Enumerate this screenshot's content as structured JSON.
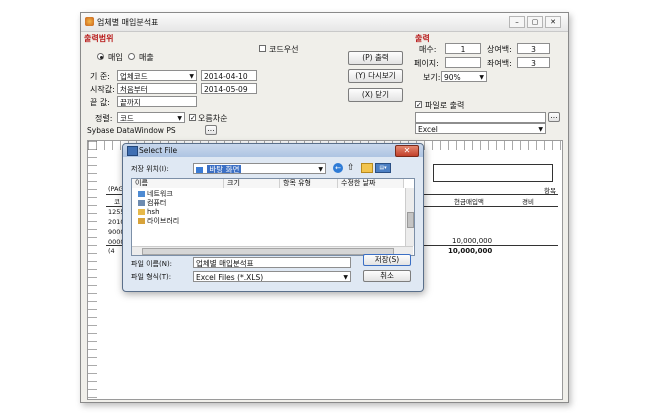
{
  "window": {
    "title": "업체별 매입분석표"
  },
  "output_range": {
    "heading": "출력범위",
    "radio_purchase": "매입",
    "radio_sale": "매출",
    "code_priority": "코드우선",
    "criteria_label": "기 준:",
    "criteria_value": "업체코드",
    "date_from": "2014-04-10",
    "start_label": "시작값:",
    "start_value": "처음부터",
    "date_to": "2014-05-09",
    "end_label": "끝 값:",
    "end_value": "끝까지",
    "sort_label": "정렬:",
    "sort_value": "코드",
    "ascending": "오름차순",
    "datawindow": "Sybase DataWindow PS",
    "browse": "..."
  },
  "buttons": {
    "print": "(P) 출력",
    "saveas": "(Y) 다시보기",
    "close": "(X) 닫기"
  },
  "print_panel": {
    "heading": "출력",
    "copies_label": "매수:",
    "copies_value": "1",
    "top_margin_label": "상여백:",
    "top_margin_value": "3",
    "page_label": "페이지:",
    "left_margin_label": "좌여백:",
    "left_margin_value": "3",
    "zoom_label": "보기:",
    "zoom_value": "90%",
    "to_file": "파일로 출력",
    "browse": "...",
    "format_value": "Excel"
  },
  "report": {
    "page_label": "(PAGE",
    "side_label": "항목",
    "col_cash": "현금매입액",
    "col_cost": "경비",
    "row_codes": [
      "1255",
      "20100",
      "9000",
      "0000",
      "(4"
    ],
    "row_value": "10,000,000",
    "total_value": "10,000,000",
    "col_b": "코"
  },
  "dialog": {
    "title": "Select File",
    "save_in_label": "저장 위치(I):",
    "save_in_value": "바탕 화면",
    "col_name": "이름",
    "col_size": "크기",
    "col_type": "항목 유형",
    "col_modified": "수정한 날짜",
    "items": [
      "네트워크",
      "컴퓨터",
      "hsh",
      "라이브러리"
    ],
    "filename_label": "파일 이름(N):",
    "filename_value": "업체별 매입분석표",
    "filetype_label": "파일 형식(T):",
    "filetype_value": "Excel Files (*.XLS)",
    "save": "저장(S)",
    "cancel": "취소"
  }
}
